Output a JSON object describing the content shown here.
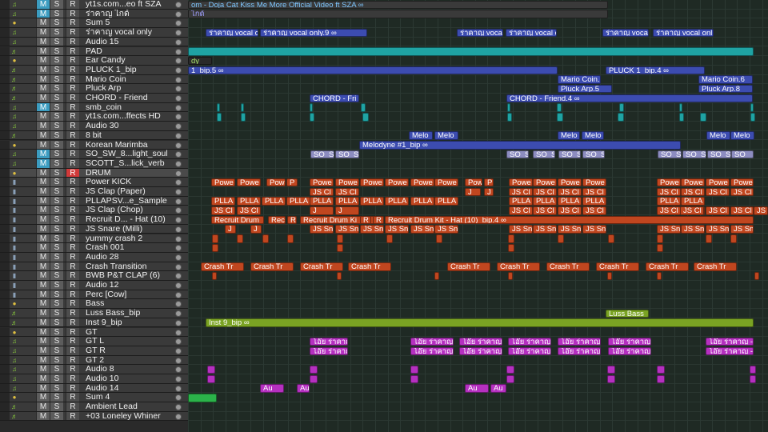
{
  "tracks": [
    {
      "name": "yt1s.com...eo ft SZA",
      "m": true,
      "r": false,
      "icon": "audio"
    },
    {
      "name": "ร่าคาญ ไกด์",
      "m": true,
      "r": false,
      "icon": "audio"
    },
    {
      "name": "Sum 5",
      "m": false,
      "r": false,
      "icon": "folder"
    },
    {
      "name": "ร่าคาญ vocal only",
      "m": false,
      "r": false,
      "icon": "audio"
    },
    {
      "name": "Audio 15",
      "m": false,
      "r": false,
      "icon": "audio"
    },
    {
      "name": "PAD",
      "m": false,
      "r": false,
      "icon": "inst"
    },
    {
      "name": "Ear Candy",
      "m": false,
      "r": false,
      "icon": "folder"
    },
    {
      "name": "PLUCK 1_bip",
      "m": false,
      "r": false,
      "icon": "inst"
    },
    {
      "name": "Mario Coin",
      "m": false,
      "r": false,
      "icon": "inst"
    },
    {
      "name": "Pluck Arp",
      "m": false,
      "r": false,
      "icon": "inst"
    },
    {
      "name": "CHORD - Friend",
      "m": false,
      "r": false,
      "icon": "inst"
    },
    {
      "name": "smb_coin",
      "m": true,
      "r": false,
      "icon": "audio"
    },
    {
      "name": "yt1s.com...ffects HD",
      "m": false,
      "r": false,
      "icon": "audio"
    },
    {
      "name": "Audio 30",
      "m": false,
      "r": false,
      "icon": "audio"
    },
    {
      "name": "8 bit",
      "m": false,
      "r": false,
      "icon": "inst"
    },
    {
      "name": "Korean Marimba",
      "m": false,
      "r": false,
      "icon": "folder"
    },
    {
      "name": "SO_SW_8...light_soul",
      "m": true,
      "r": false,
      "icon": "audio"
    },
    {
      "name": "SCOTT_S...lick_verb",
      "m": true,
      "r": false,
      "icon": "audio"
    },
    {
      "name": "DRUM",
      "m": false,
      "r": true,
      "icon": "folder"
    },
    {
      "name": "Power KICK",
      "m": false,
      "r": false,
      "icon": "drum"
    },
    {
      "name": "JS Clap (Paper)",
      "m": false,
      "r": false,
      "icon": "drum"
    },
    {
      "name": "PLLAPSV...e_Sample",
      "m": false,
      "r": false,
      "icon": "drum"
    },
    {
      "name": "JS Clap (Chop)",
      "m": false,
      "r": false,
      "icon": "drum"
    },
    {
      "name": "Recruit D... - Hat (10)",
      "m": false,
      "r": false,
      "icon": "drum"
    },
    {
      "name": "JS Snare (Milli)",
      "m": false,
      "r": false,
      "icon": "drum"
    },
    {
      "name": "yummy crash 2",
      "m": false,
      "r": false,
      "icon": "drum"
    },
    {
      "name": "Crash 001",
      "m": false,
      "r": false,
      "icon": "drum"
    },
    {
      "name": "Audio 28",
      "m": false,
      "r": false,
      "icon": "drum"
    },
    {
      "name": "Crash Transition",
      "m": false,
      "r": false,
      "icon": "drum"
    },
    {
      "name": "BWB P&T CLAP (6)",
      "m": false,
      "r": false,
      "icon": "drum"
    },
    {
      "name": "Audio 12",
      "m": false,
      "r": false,
      "icon": "drum"
    },
    {
      "name": "Perc [Cow]",
      "m": false,
      "r": false,
      "icon": "drum"
    },
    {
      "name": "Bass",
      "m": false,
      "r": false,
      "icon": "folder"
    },
    {
      "name": "Luss Bass_bip",
      "m": false,
      "r": false,
      "icon": "inst"
    },
    {
      "name": "Inst 9_bip",
      "m": false,
      "r": false,
      "icon": "inst"
    },
    {
      "name": "GT",
      "m": false,
      "r": false,
      "icon": "folder"
    },
    {
      "name": "GT L",
      "m": false,
      "r": false,
      "icon": "audio"
    },
    {
      "name": "GT R",
      "m": false,
      "r": false,
      "icon": "audio"
    },
    {
      "name": "GT 2",
      "m": false,
      "r": false,
      "icon": "audio"
    },
    {
      "name": "Audio 8",
      "m": false,
      "r": false,
      "icon": "audio"
    },
    {
      "name": "Audio 10",
      "m": false,
      "r": false,
      "icon": "audio"
    },
    {
      "name": "Audio 14",
      "m": false,
      "r": false,
      "icon": "audio"
    },
    {
      "name": "Sum 4",
      "m": false,
      "r": false,
      "icon": "folder"
    },
    {
      "name": "Ambient Lead",
      "m": false,
      "r": false,
      "icon": "inst"
    },
    {
      "name": "+03 Loneley Whiner",
      "m": false,
      "r": false,
      "icon": "inst"
    }
  ],
  "button_labels": {
    "mute": "M",
    "solo": "S",
    "record": "R"
  },
  "colors": {
    "blue": "#3c4cb0",
    "teal": "#1fa3a3",
    "orange": "#c0461f",
    "magenta": "#b530c0",
    "olive": "#7aa323",
    "green": "#2bb34a",
    "light": "#8c8cc0"
  },
  "regions": [
    {
      "track": 0,
      "text": "om - Doja Cat  Kiss Me More Official Video ft SZA  ∞",
      "color": "#3a3a3a",
      "textcolor": "#7ec8ff"
    },
    {
      "track": 1,
      "text": "ไกด์",
      "color": "#3a3a3a",
      "textcolor": "#a0a0ff"
    },
    {
      "track": 3,
      "text": "ร่าคาญ vocal o",
      "color": "blue"
    },
    {
      "track": 3,
      "text": "ร่าคาญ vocal only.9  ∞",
      "color": "blue"
    },
    {
      "track": 3,
      "text": "ร่าคาญ vocal",
      "color": "blue"
    },
    {
      "track": 3,
      "text": "ร่าคาญ vocal onl",
      "color": "blue"
    },
    {
      "track": 3,
      "text": "ร่าคาญ vocal",
      "color": "blue"
    },
    {
      "track": 3,
      "text": "ร่าคาญ vocal onl",
      "color": "blue"
    },
    {
      "track": 5,
      "text": "",
      "color": "teal"
    },
    {
      "track": 6,
      "text": "dy",
      "color": "#2a2a2a",
      "textcolor": "#a6e36b"
    },
    {
      "track": 7,
      "text": "1_bip.5  ∞",
      "color": "blue"
    },
    {
      "track": 7,
      "text": "PLUCK 1_bip.4  ∞",
      "color": "blue"
    },
    {
      "track": 8,
      "text": "Mario Coin.3",
      "color": "blue"
    },
    {
      "track": 8,
      "text": "Mario Coin.6",
      "color": "blue"
    },
    {
      "track": 9,
      "text": "Pluck Arp.5",
      "color": "blue"
    },
    {
      "track": 9,
      "text": "Pluck Arp.8",
      "color": "blue"
    },
    {
      "track": 10,
      "text": "CHORD - Fri",
      "color": "blue"
    },
    {
      "track": 10,
      "text": "CHORD - Friend.4  ∞",
      "color": "blue"
    },
    {
      "track": 14,
      "text": "Melo",
      "color": "blue"
    },
    {
      "track": 14,
      "text": "Melo",
      "color": "blue"
    },
    {
      "track": 14,
      "text": "Melo",
      "color": "blue"
    },
    {
      "track": 14,
      "text": "Melo",
      "color": "blue"
    },
    {
      "track": 14,
      "text": "Melo",
      "color": "blue"
    },
    {
      "track": 14,
      "text": "Melo",
      "color": "blue"
    },
    {
      "track": 15,
      "text": "Melodyne #1_bip  ∞",
      "color": "blue"
    },
    {
      "track": 16,
      "text": "SO_S",
      "color": "light"
    },
    {
      "track": 16,
      "text": "SO_S",
      "color": "light"
    },
    {
      "track": 16,
      "text": "SO_S",
      "color": "light"
    },
    {
      "track": 16,
      "text": "SO_S",
      "color": "light"
    },
    {
      "track": 16,
      "text": "SO_S",
      "color": "light"
    },
    {
      "track": 16,
      "text": "SO_S",
      "color": "light"
    },
    {
      "track": 16,
      "text": "SO_S",
      "color": "light"
    },
    {
      "track": 16,
      "text": "SO_S",
      "color": "light"
    },
    {
      "track": 16,
      "text": "SO_S",
      "color": "light"
    },
    {
      "track": 16,
      "text": "SO_",
      "color": "light"
    },
    {
      "track": 19,
      "text": "Powe",
      "color": "orange"
    },
    {
      "track": 19,
      "text": "Powe",
      "color": "orange"
    },
    {
      "track": 19,
      "text": "Pow",
      "color": "orange"
    },
    {
      "track": 19,
      "text": "P",
      "color": "orange"
    },
    {
      "track": 19,
      "text": "Powe",
      "color": "orange"
    },
    {
      "track": 19,
      "text": "Powe",
      "color": "orange"
    },
    {
      "track": 19,
      "text": "Powe",
      "color": "orange"
    },
    {
      "track": 19,
      "text": "Powe",
      "color": "orange"
    },
    {
      "track": 19,
      "text": "Powe",
      "color": "orange"
    },
    {
      "track": 19,
      "text": "Powe",
      "color": "orange"
    },
    {
      "track": 19,
      "text": "Pow",
      "color": "orange"
    },
    {
      "track": 19,
      "text": "P",
      "color": "orange"
    },
    {
      "track": 19,
      "text": "Powe",
      "color": "orange"
    },
    {
      "track": 19,
      "text": "Powe",
      "color": "orange"
    },
    {
      "track": 19,
      "text": "Powe",
      "color": "orange"
    },
    {
      "track": 19,
      "text": "Powe",
      "color": "orange"
    },
    {
      "track": 19,
      "text": "Powe",
      "color": "orange"
    },
    {
      "track": 19,
      "text": "Powe",
      "color": "orange"
    },
    {
      "track": 19,
      "text": "Powe",
      "color": "orange"
    },
    {
      "track": 19,
      "text": "Powe",
      "color": "orange"
    },
    {
      "track": 20,
      "text": "JS Cl",
      "color": "orange"
    },
    {
      "track": 20,
      "text": "JS Cl",
      "color": "orange"
    },
    {
      "track": 20,
      "text": "J",
      "color": "orange"
    },
    {
      "track": 20,
      "text": "J",
      "color": "orange"
    },
    {
      "track": 20,
      "text": "JS Cl",
      "color": "orange"
    },
    {
      "track": 20,
      "text": "JS Cl",
      "color": "orange"
    },
    {
      "track": 20,
      "text": "JS Cl",
      "color": "orange"
    },
    {
      "track": 20,
      "text": "JS Cl",
      "color": "orange"
    },
    {
      "track": 20,
      "text": "JS Cl",
      "color": "orange"
    },
    {
      "track": 20,
      "text": "JS Cl",
      "color": "orange"
    },
    {
      "track": 20,
      "text": "JS Cl",
      "color": "orange"
    },
    {
      "track": 20,
      "text": "JS Cl",
      "color": "orange"
    },
    {
      "track": 21,
      "text": "PLLA",
      "color": "orange"
    },
    {
      "track": 21,
      "text": "PLLA",
      "color": "orange"
    },
    {
      "track": 21,
      "text": "PLLA",
      "color": "orange"
    },
    {
      "track": 21,
      "text": "PLLA",
      "color": "orange"
    },
    {
      "track": 21,
      "text": "PLLA",
      "color": "orange"
    },
    {
      "track": 21,
      "text": "PLLA",
      "color": "orange"
    },
    {
      "track": 21,
      "text": "PLLA",
      "color": "orange"
    },
    {
      "track": 21,
      "text": "PLLA",
      "color": "orange"
    },
    {
      "track": 21,
      "text": "PLLA",
      "color": "orange"
    },
    {
      "track": 21,
      "text": "PLLA",
      "color": "orange"
    },
    {
      "track": 21,
      "text": "PLLA",
      "color": "orange"
    },
    {
      "track": 21,
      "text": "PLLA",
      "color": "orange"
    },
    {
      "track": 21,
      "text": "PLLA",
      "color": "orange"
    },
    {
      "track": 21,
      "text": "PLLA",
      "color": "orange"
    },
    {
      "track": 21,
      "text": "PLLA",
      "color": "orange"
    },
    {
      "track": 21,
      "text": "PLLA",
      "color": "orange"
    },
    {
      "track": 22,
      "text": "JS Cl",
      "color": "orange"
    },
    {
      "track": 22,
      "text": "JS Cl",
      "color": "orange"
    },
    {
      "track": 22,
      "text": "J",
      "color": "orange"
    },
    {
      "track": 22,
      "text": "J",
      "color": "orange"
    },
    {
      "track": 22,
      "text": "JS Cl",
      "color": "orange"
    },
    {
      "track": 22,
      "text": "JS Cl",
      "color": "orange"
    },
    {
      "track": 22,
      "text": "JS Cl",
      "color": "orange"
    },
    {
      "track": 22,
      "text": "JS Cl",
      "color": "orange"
    },
    {
      "track": 22,
      "text": "JS Cl",
      "color": "orange"
    },
    {
      "track": 22,
      "text": "JS Cl",
      "color": "orange"
    },
    {
      "track": 22,
      "text": "JS Cl",
      "color": "orange"
    },
    {
      "track": 22,
      "text": "JS Cl",
      "color": "orange"
    },
    {
      "track": 22,
      "text": "JS Cl",
      "color": "orange"
    },
    {
      "track": 22,
      "text": "JS Cl",
      "color": "orange"
    },
    {
      "track": 22,
      "text": "JS Cl",
      "color": "orange"
    },
    {
      "track": 22,
      "text": "JS Cl",
      "color": "orange"
    },
    {
      "track": 23,
      "text": "Recruit Drum",
      "color": "orange"
    },
    {
      "track": 23,
      "text": "Rec",
      "color": "orange"
    },
    {
      "track": 23,
      "text": "R",
      "color": "orange"
    },
    {
      "track": 23,
      "text": "Recruit Drum Ki",
      "color": "orange"
    },
    {
      "track": 23,
      "text": "R",
      "color": "orange"
    },
    {
      "track": 23,
      "text": "R",
      "color": "orange"
    },
    {
      "track": 23,
      "text": "Recruit Drum Kit - Hat (10)_bip.4  ∞",
      "color": "orange"
    },
    {
      "track": 24,
      "text": "J",
      "color": "orange"
    },
    {
      "track": 24,
      "text": "J",
      "color": "orange"
    },
    {
      "track": 24,
      "text": "JS Sn",
      "color": "orange"
    },
    {
      "track": 24,
      "text": "JS Sn",
      "color": "orange"
    },
    {
      "track": 24,
      "text": "JS Sn",
      "color": "orange"
    },
    {
      "track": 24,
      "text": "JS Sn",
      "color": "orange"
    },
    {
      "track": 24,
      "text": "JS Sn",
      "color": "orange"
    },
    {
      "track": 24,
      "text": "JS Sn",
      "color": "orange"
    },
    {
      "track": 24,
      "text": "JS Sn",
      "color": "orange"
    },
    {
      "track": 24,
      "text": "JS Sn",
      "color": "orange"
    },
    {
      "track": 24,
      "text": "JS Sn",
      "color": "orange"
    },
    {
      "track": 24,
      "text": "JS Sn",
      "color": "orange"
    },
    {
      "track": 24,
      "text": "JS Sn",
      "color": "orange"
    },
    {
      "track": 24,
      "text": "JS Sn",
      "color": "orange"
    },
    {
      "track": 24,
      "text": "JS Sn",
      "color": "orange"
    },
    {
      "track": 24,
      "text": "JS Sn",
      "color": "orange"
    },
    {
      "track": 28,
      "text": "Crash Tr",
      "color": "orange"
    },
    {
      "track": 28,
      "text": "Crash Tr",
      "color": "orange"
    },
    {
      "track": 28,
      "text": "Crash Tr",
      "color": "orange"
    },
    {
      "track": 28,
      "text": "Crash Tr",
      "color": "orange"
    },
    {
      "track": 28,
      "text": "Crash Tr",
      "color": "orange"
    },
    {
      "track": 28,
      "text": "Crash Tr",
      "color": "orange"
    },
    {
      "track": 28,
      "text": "Crash Tr",
      "color": "orange"
    },
    {
      "track": 28,
      "text": "Crash Tr",
      "color": "orange"
    },
    {
      "track": 28,
      "text": "Crash Tr",
      "color": "orange"
    },
    {
      "track": 28,
      "text": "Crash Tr",
      "color": "orange"
    },
    {
      "track": 33,
      "text": "Luss Bass_",
      "color": "olive"
    },
    {
      "track": 34,
      "text": "Inst 9_bip  ∞",
      "color": "olive"
    },
    {
      "track": 36,
      "text": "โอ๊ย ร่าคาญ -",
      "color": "magenta"
    },
    {
      "track": 36,
      "text": "โอ๊ย ร่าคาญ -",
      "color": "magenta"
    },
    {
      "track": 36,
      "text": "โอ๊ย ร่าคาญ -",
      "color": "magenta"
    },
    {
      "track": 36,
      "text": "โอ๊ย ร่าคาญ -",
      "color": "magenta"
    },
    {
      "track": 36,
      "text": "โอ๊ย ร่าคาญ -",
      "color": "magenta"
    },
    {
      "track": 36,
      "text": "โอ๊ย ร่าคาญ -",
      "color": "magenta"
    },
    {
      "track": 36,
      "text": "โอ๊ย ร่าคาญ -",
      "color": "magenta"
    },
    {
      "track": 37,
      "text": "โอ๊ย ร่าคาญ -",
      "color": "magenta"
    },
    {
      "track": 37,
      "text": "โอ๊ย ร่าคาญ -",
      "color": "magenta"
    },
    {
      "track": 37,
      "text": "โอ๊ย ร่าคาญ -",
      "color": "magenta"
    },
    {
      "track": 37,
      "text": "โอ๊ย ร่าคาญ -",
      "color": "magenta"
    },
    {
      "track": 37,
      "text": "โอ๊ย ร่าคาญ -",
      "color": "magenta"
    },
    {
      "track": 37,
      "text": "โอ๊ย ร่าคาญ -",
      "color": "magenta"
    },
    {
      "track": 37,
      "text": "โอ๊ย ร่าคาญ -",
      "color": "magenta"
    },
    {
      "track": 41,
      "text": "Au",
      "color": "magenta"
    },
    {
      "track": 41,
      "text": "Au",
      "color": "magenta"
    },
    {
      "track": 41,
      "text": "Au",
      "color": "magenta"
    },
    {
      "track": 41,
      "text": "Au",
      "color": "magenta"
    },
    {
      "track": 42,
      "text": "",
      "color": "green"
    }
  ]
}
